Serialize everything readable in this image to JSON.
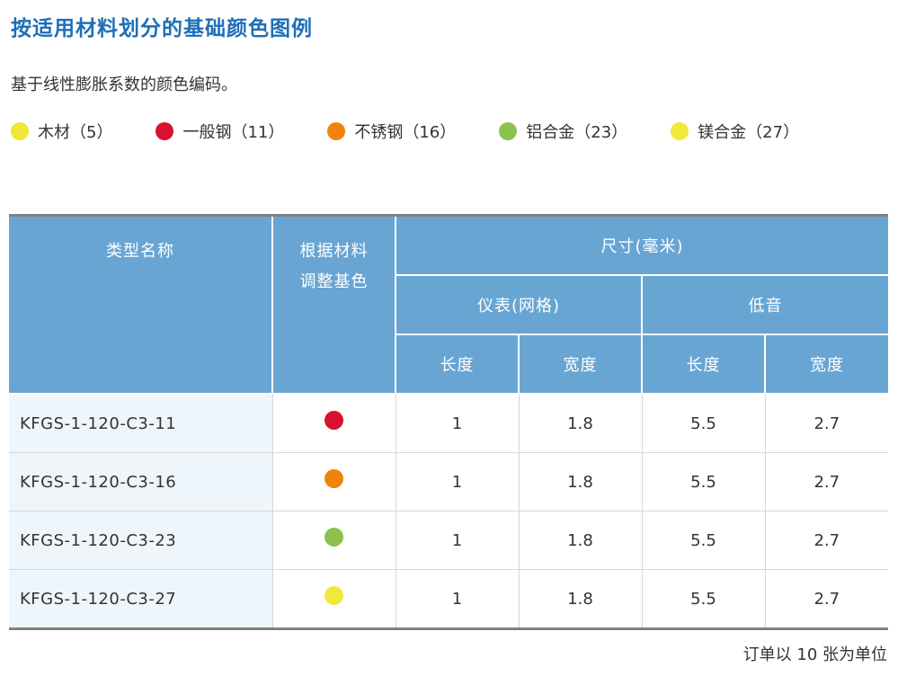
{
  "title": "按适用材料划分的基础颜色图例",
  "description": "基于线性膨胀系数的颜色编码。",
  "legend": [
    {
      "label": "木材（5）",
      "color": "#f0e63a"
    },
    {
      "label": "一般钢（11）",
      "color": "#d7112e"
    },
    {
      "label": "不锈钢（16）",
      "color": "#ef840d"
    },
    {
      "label": "铝合金（23）",
      "color": "#8cc24c"
    },
    {
      "label": "镁合金（27）",
      "color": "#f2e73c"
    }
  ],
  "table": {
    "headers": {
      "type_name": "类型名称",
      "color_adjust_line1": "根据材料",
      "color_adjust_line2": "调整基色",
      "size": "尺寸(毫米)",
      "meter": "仪表(网格)",
      "bass": "低音",
      "length": "长度",
      "width": "宽度"
    },
    "rows": [
      {
        "name": "KFGS-1-120-C3-11",
        "dot_color": "#d7112e",
        "meter_length": "1",
        "meter_width": "1.8",
        "bass_length": "5.5",
        "bass_width": "2.7"
      },
      {
        "name": "KFGS-1-120-C3-16",
        "dot_color": "#ef840d",
        "meter_length": "1",
        "meter_width": "1.8",
        "bass_length": "5.5",
        "bass_width": "2.7"
      },
      {
        "name": "KFGS-1-120-C3-23",
        "dot_color": "#8cc24c",
        "meter_length": "1",
        "meter_width": "1.8",
        "bass_length": "5.5",
        "bass_width": "2.7"
      },
      {
        "name": "KFGS-1-120-C3-27",
        "dot_color": "#f2e73c",
        "meter_length": "1",
        "meter_width": "1.8",
        "bass_length": "5.5",
        "bass_width": "2.7"
      }
    ]
  },
  "note": "订单以 10 张为单位",
  "colors": {
    "title": "#1f6fb8",
    "header_bg": "#68a5d3",
    "name_cell_bg": "#eef6fc"
  }
}
